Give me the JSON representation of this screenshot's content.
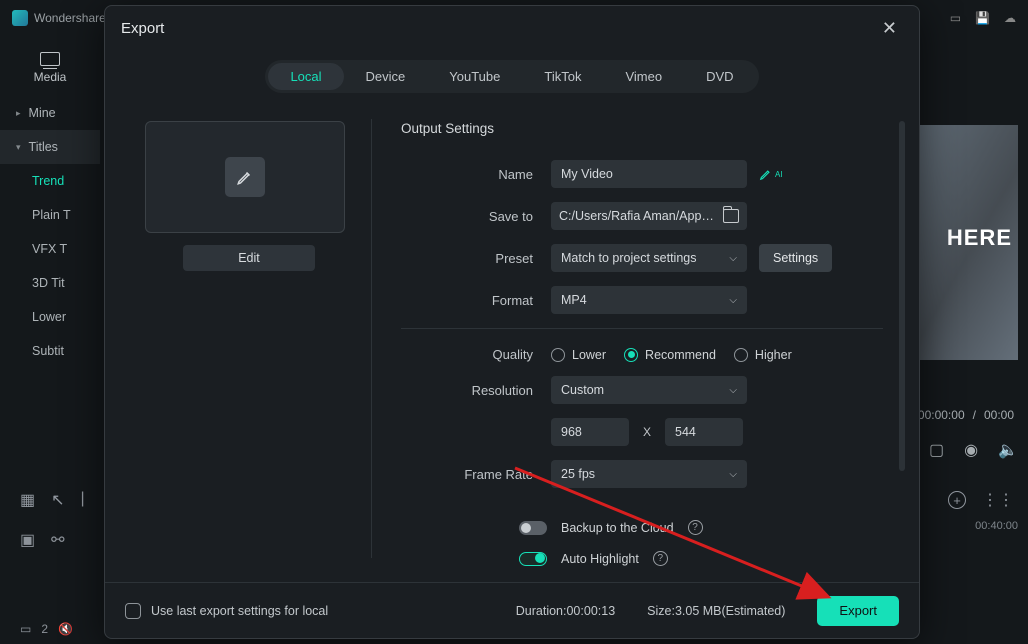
{
  "app": {
    "brand": "Wondershare"
  },
  "bg": {
    "media_tab": "Media",
    "side": {
      "mine": "Mine",
      "titles": "Titles",
      "items": [
        "Trend",
        "Plain T",
        "VFX T",
        "3D Tit",
        "Lower",
        "Subtit"
      ]
    },
    "preview_text": "HERE",
    "time_current": "00:00:00",
    "time_total": "00:00",
    "ruler_mark": "00:40:00",
    "bottom_left_count": "2"
  },
  "modal": {
    "title": "Export",
    "tabs": [
      "Local",
      "Device",
      "YouTube",
      "TikTok",
      "Vimeo",
      "DVD"
    ],
    "active_tab": 0,
    "edit_btn": "Edit",
    "section_title": "Output Settings",
    "labels": {
      "name": "Name",
      "save_to": "Save to",
      "preset": "Preset",
      "format": "Format",
      "quality": "Quality",
      "resolution": "Resolution",
      "frame_rate": "Frame Rate"
    },
    "values": {
      "name": "My Video",
      "save_path": "C:/Users/Rafia Aman/AppData",
      "preset": "Match to project settings",
      "settings_btn": "Settings",
      "format": "MP4",
      "quality_options": {
        "lower": "Lower",
        "recommend": "Recommend",
        "higher": "Higher"
      },
      "quality_selected": "recommend",
      "resolution_mode": "Custom",
      "res_w": "968",
      "res_h": "544",
      "res_sep": "X",
      "frame_rate": "25 fps"
    },
    "toggles": {
      "backup_cloud": {
        "label": "Backup to the Cloud",
        "on": false
      },
      "auto_highlight": {
        "label": "Auto Highlight",
        "on": true
      }
    },
    "footer": {
      "chk_label": "Use last export settings for local",
      "duration_label": "Duration:",
      "duration": "00:00:13",
      "size_label": "Size:",
      "size": "3.05 MB(Estimated)",
      "export_btn": "Export"
    }
  }
}
